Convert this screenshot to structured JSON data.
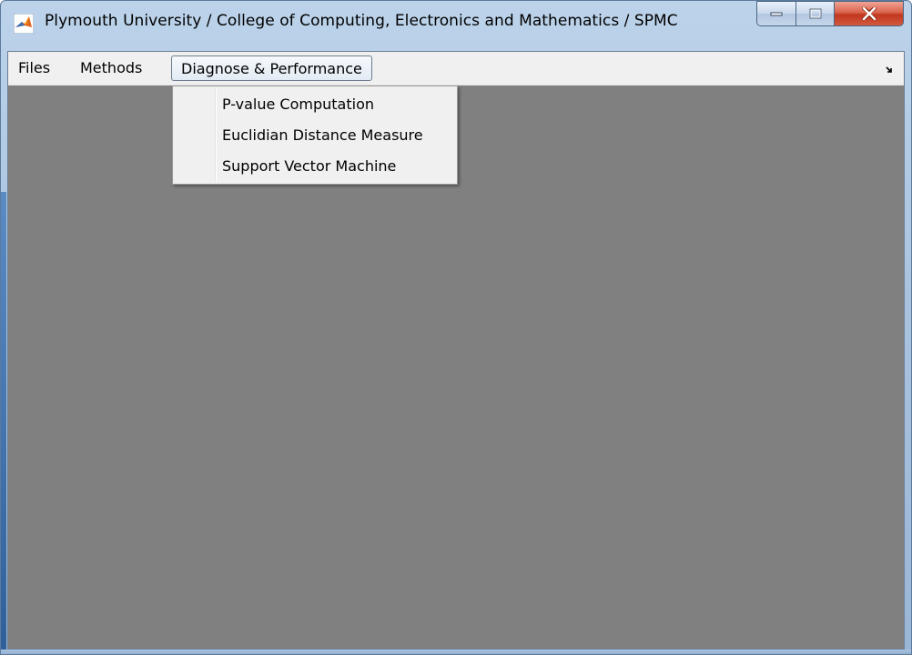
{
  "window": {
    "title": "Plymouth University / College of Computing, Electronics and Mathematics / SPMC",
    "icon": "matlab-icon"
  },
  "caption_buttons": {
    "minimize_icon": "minimize-icon",
    "maximize_icon": "maximize-icon",
    "close_icon": "close-icon"
  },
  "menubar": {
    "items": [
      {
        "label": "Files"
      },
      {
        "label": "Methods"
      },
      {
        "label": "Diagnose & Performance",
        "active": true
      }
    ],
    "overflow_icon": "toolbar-overflow-icon"
  },
  "dropdown": {
    "items": [
      {
        "label": "P-value Computation"
      },
      {
        "label": "Euclidian Distance Measure"
      },
      {
        "label": "Support Vector Machine"
      }
    ]
  },
  "colors": {
    "canvas": "#808080",
    "menubar": "#f0f0f0",
    "close_button": "#c1371f",
    "title_frame": "#a9c3df"
  }
}
